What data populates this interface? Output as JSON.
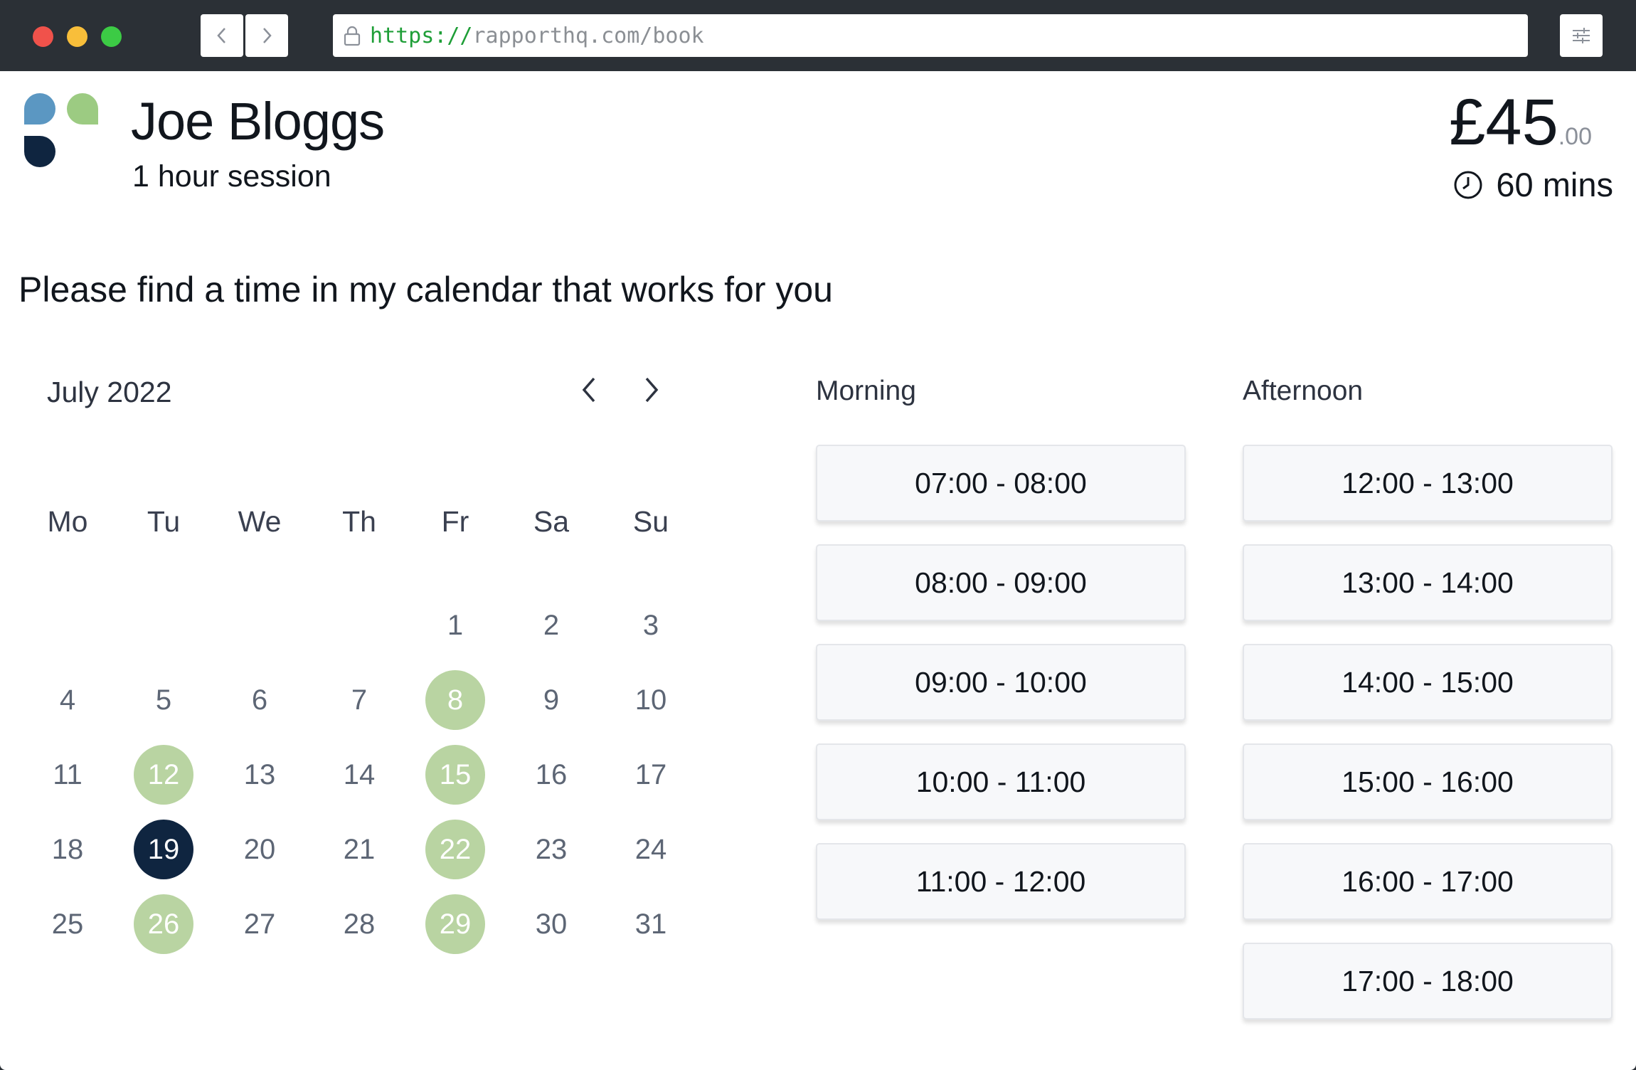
{
  "browser": {
    "url_scheme": "https://",
    "url_rest": "rapporthq.com/book",
    "icons": [
      "back-icon",
      "forward-icon",
      "lock-icon",
      "settings-sliders-icon"
    ]
  },
  "header": {
    "name": "Joe Bloggs",
    "session": "1 hour session",
    "price_main": "£45",
    "price_cents": ".00",
    "duration": "60 mins"
  },
  "prompt": "Please find a time in my calendar that works for you",
  "calendar": {
    "month": "July 2022",
    "weekdays": [
      "Mo",
      "Tu",
      "We",
      "Th",
      "Fr",
      "Sa",
      "Su"
    ],
    "first_weekday_index": 4,
    "days_in_month": 31,
    "available_days": [
      8,
      12,
      15,
      22,
      26,
      29
    ],
    "selected_day": 19
  },
  "slots": {
    "morning_label": "Morning",
    "afternoon_label": "Afternoon",
    "morning": [
      "07:00 - 08:00",
      "08:00 - 09:00",
      "09:00 - 10:00",
      "10:00 - 11:00",
      "11:00 - 12:00"
    ],
    "afternoon": [
      "12:00 - 13:00",
      "13:00 - 14:00",
      "14:00 - 15:00",
      "15:00 - 16:00",
      "16:00 - 17:00",
      "17:00 - 18:00"
    ]
  },
  "colors": {
    "available": "#b9d4a2",
    "selected": "#0f2540",
    "logo_blue": "#5b97c2",
    "logo_green": "#9ccb82",
    "logo_navy": "#0f2540"
  }
}
